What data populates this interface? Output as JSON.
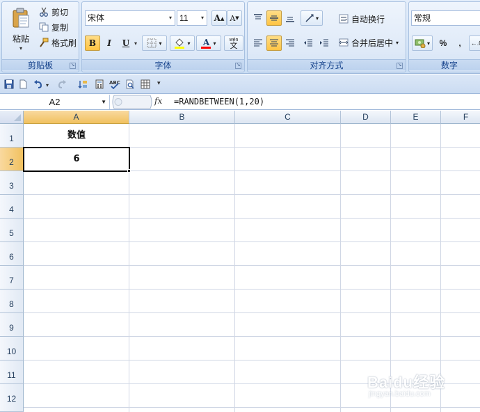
{
  "ribbon": {
    "clipboard": {
      "paste": "粘贴",
      "cut": "剪切",
      "copy": "复制",
      "format_painter": "格式刷",
      "label": "剪贴板"
    },
    "font": {
      "font_name": "宋体",
      "font_size": "11",
      "grow": "A",
      "shrink": "A",
      "bold": "B",
      "italic": "I",
      "underline": "U",
      "font_color_letter": "A",
      "phonetic": "wén",
      "phonetic_char": "文",
      "label": "字体",
      "highlight_color": "#ffff00",
      "font_color": "#ff0000"
    },
    "alignment": {
      "wrap_text": "自动换行",
      "merge_center": "合并后居中",
      "label": "对齐方式"
    },
    "number": {
      "format": "常规",
      "percent": "%",
      "comma": ",",
      "label": "数字"
    }
  },
  "formula_bar": {
    "name_box": "A2",
    "fx": "fx",
    "formula": "=RANDBETWEEN(1,20)"
  },
  "grid": {
    "columns": [
      "A",
      "B",
      "C",
      "D",
      "E",
      "F"
    ],
    "rows": [
      "1",
      "2",
      "3",
      "4",
      "5",
      "6",
      "7",
      "8",
      "9",
      "10",
      "11",
      "12"
    ],
    "cells": {
      "A1": "数值",
      "A2": "6"
    },
    "selected_cell": "A2"
  },
  "watermark": {
    "text": "Baidu经验",
    "sub": "jingyan.baidu.com"
  }
}
